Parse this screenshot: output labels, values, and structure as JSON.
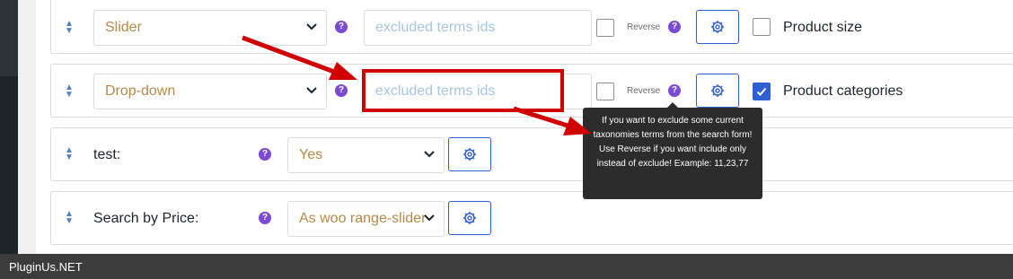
{
  "rows": [
    {
      "type_select": "Slider",
      "excluded_placeholder": "excluded terms ids",
      "reverse_label": "Reverse",
      "field_label": "Product size",
      "checked": false
    },
    {
      "type_select": "Drop-down",
      "excluded_placeholder": "excluded terms ids",
      "reverse_label": "Reverse",
      "field_label": "Product categories",
      "checked": true
    },
    {
      "label": "test:",
      "select_value": "Yes"
    },
    {
      "label": "Search by Price:",
      "select_value": "As woo range-slider"
    }
  ],
  "tooltip": {
    "text": "If you want to exclude some current taxonomies terms from the search form! Use Reverse if you want include only instead of exclude! Example: 11,23,77"
  },
  "footer": {
    "brand": "PluginUs.NET"
  },
  "colors": {
    "accent": "#2f5fd0",
    "help": "#7b4bd1",
    "highlight": "#d00000",
    "select_text": "#b5894a"
  }
}
